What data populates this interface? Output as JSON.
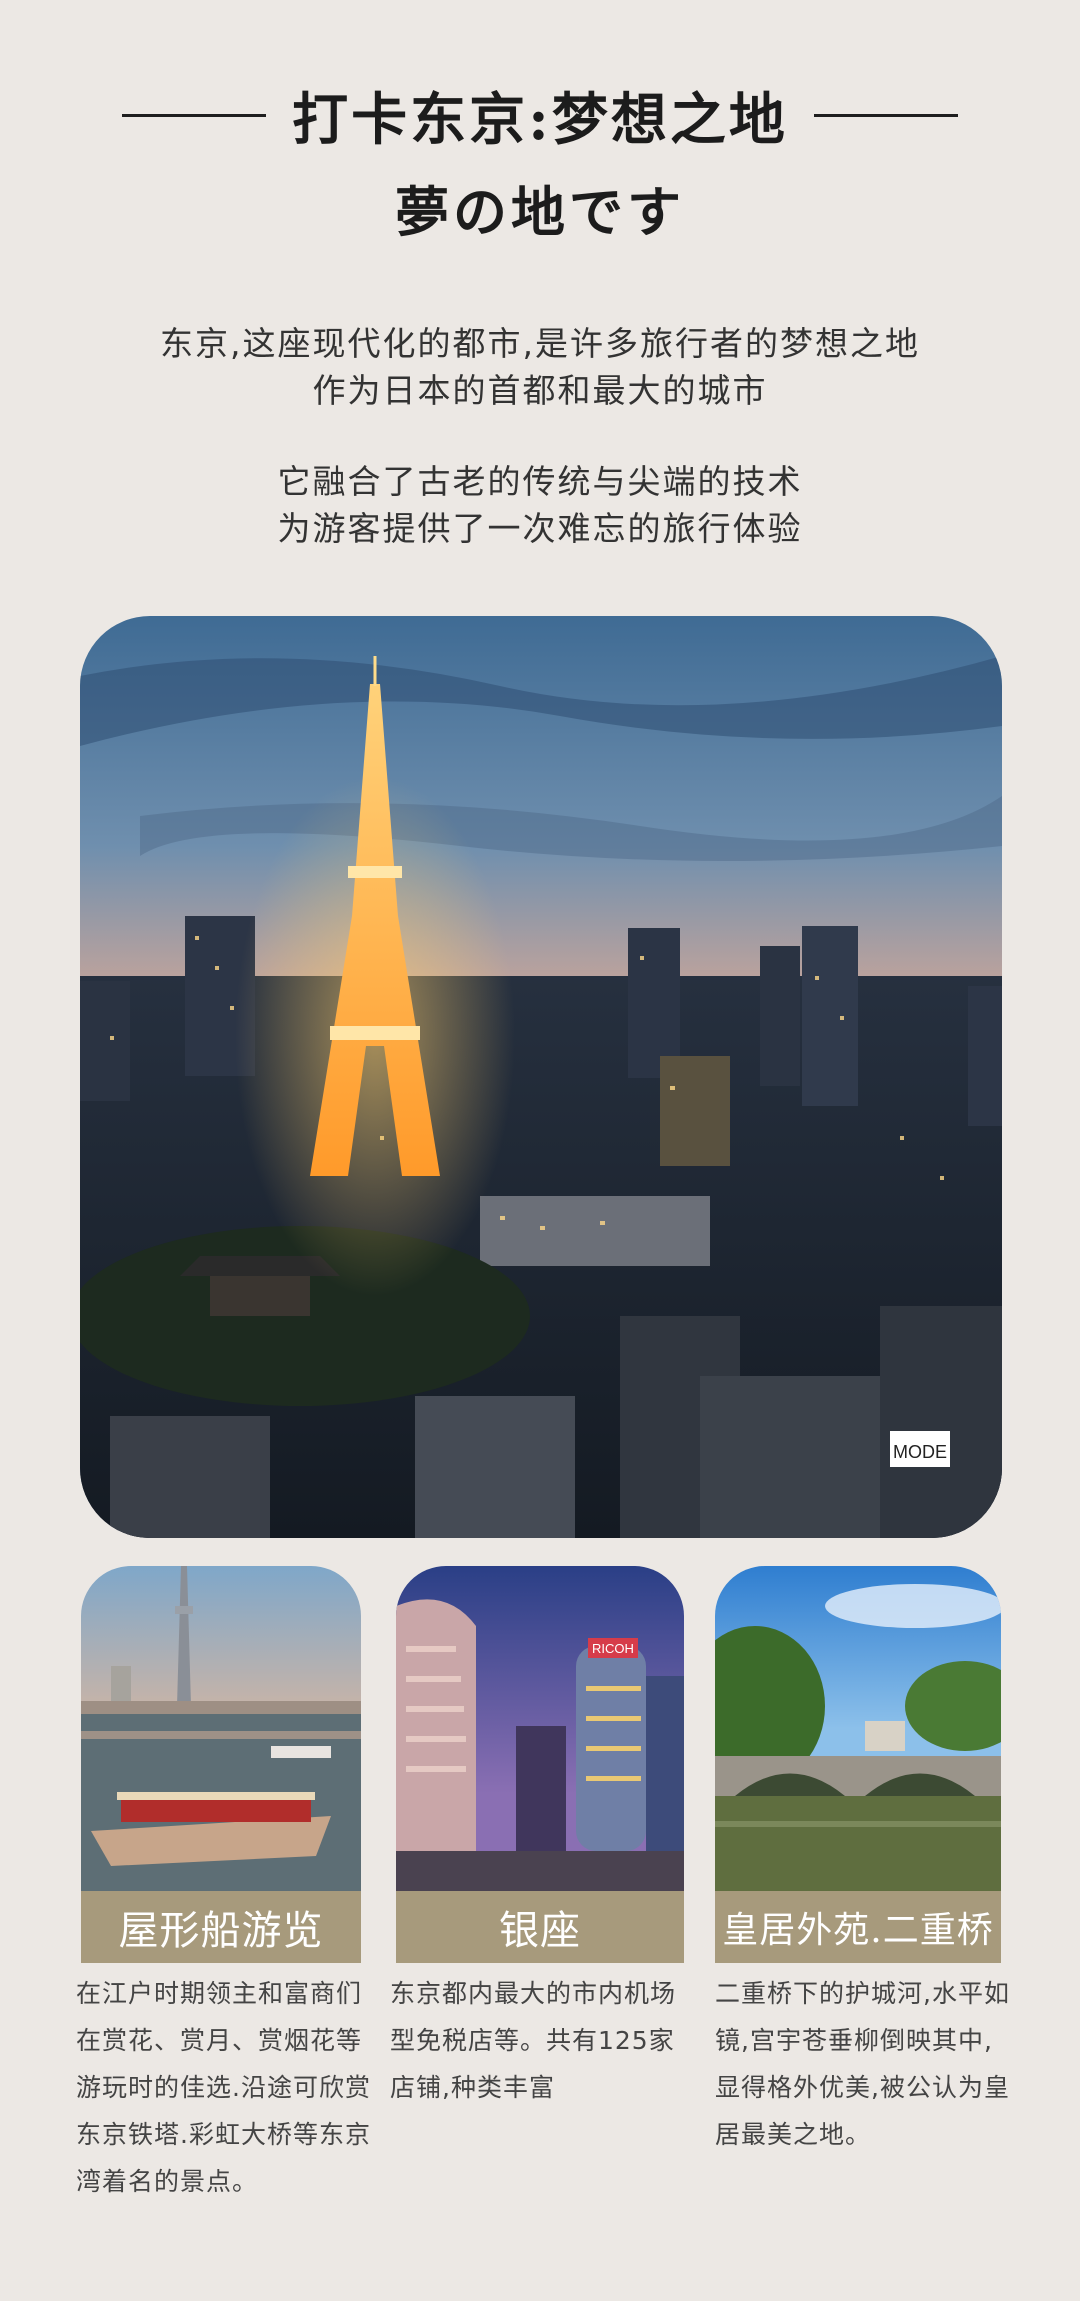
{
  "header": {
    "title": "打卡东京:梦想之地",
    "subtitle": "夢の地です"
  },
  "intro": {
    "paragraph1": [
      "东京,这座现代化的都市,是许多旅行者的梦想之地",
      "作为日本的首都和最大的城市"
    ],
    "paragraph2": [
      "它融合了古老的传统与尖端的技术",
      "为游客提供了一次难忘的旅行体验"
    ]
  },
  "hero": {
    "sign_text": "MODE"
  },
  "cards": [
    {
      "label": "屋形船游览",
      "description": "在江户时期领主和富商们在赏花、赏月、赏烟花等游玩时的佳选.沿途可欣赏东京铁塔.彩虹大桥等东京湾着名的景点。"
    },
    {
      "label": "银座",
      "description": "东京都内最大的市内机场型免税店等。共有125家店铺,种类丰富",
      "sign_text": "RICOH"
    },
    {
      "label": "皇居外苑.二重桥",
      "description": "二重桥下的护城河,水平如镜,宫宇苍垂柳倒映其中,显得格外优美,被公认为皇居最美之地。"
    }
  ],
  "colors": {
    "background": "#ece8e4",
    "label_bar": "#a79a7c",
    "text": "#1c1c1c"
  }
}
